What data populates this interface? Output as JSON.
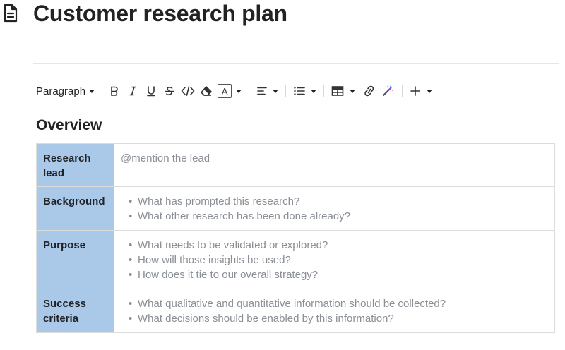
{
  "page": {
    "title": "Customer research plan",
    "icon": "document-icon"
  },
  "toolbar": {
    "paragraph_label": "Paragraph",
    "text_color_glyph": "A",
    "buttons": [
      "bold-icon",
      "italic-icon",
      "underline-icon",
      "strikethrough-icon",
      "code-icon",
      "eraser-icon",
      "text-color-icon",
      "align-icon",
      "bullet-list-icon",
      "table-icon",
      "link-icon",
      "magic-wand-icon",
      "plus-icon"
    ]
  },
  "overview": {
    "heading": "Overview",
    "rows": [
      {
        "label": "Research lead",
        "placeholder": "@mention the lead",
        "bullets": []
      },
      {
        "label": "Background",
        "bullets": [
          "What has prompted this research?",
          "What other research has been done already?"
        ]
      },
      {
        "label": "Purpose",
        "bullets": [
          "What needs to be validated or explored?",
          "How will those insights be used?",
          "How does it tie to our overall strategy?"
        ]
      },
      {
        "label": "Success criteria",
        "bullets": [
          "What qualitative and quantitative information should be collected?",
          "What decisions should be enabled by this information?"
        ]
      }
    ]
  },
  "colors": {
    "label_cell_bg": "#aac8e8",
    "placeholder_text": "#8a8f96",
    "magic_wand_accent": "#6d4aff"
  }
}
